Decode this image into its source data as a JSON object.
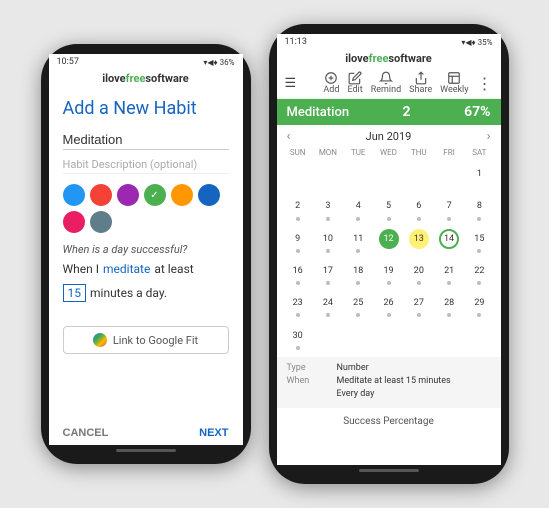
{
  "brand": {
    "name_part1": "ilove",
    "name_part2": "free",
    "name_part3": "software"
  },
  "left_phone": {
    "status": {
      "time": "10:57",
      "battery": "36%",
      "icons": "▾◀♦"
    },
    "title": "Add a New Habit",
    "habit_name_value": "Meditation",
    "habit_description_placeholder": "Habit Description (optional)",
    "colors": [
      {
        "color": "#2196f3",
        "active": false
      },
      {
        "color": "#f44336",
        "active": false
      },
      {
        "color": "#9c27b0",
        "active": false
      },
      {
        "color": "#4caf50",
        "active": true,
        "checkmark": "✓"
      },
      {
        "color": "#ff9800",
        "active": false
      },
      {
        "color": "#1565c0",
        "active": false
      },
      {
        "color": "#e91e63",
        "active": false
      },
      {
        "color": "#607d8b",
        "active": false
      }
    ],
    "when_question": "When is a day successful?",
    "when_prefix": "When I",
    "when_activity": "meditate",
    "when_condition": "at least",
    "minutes_value": "15",
    "minutes_label": "minutes a day.",
    "google_fit_label": "Link to Google Fit",
    "cancel_label": "CANCEL",
    "next_label": "NEXT"
  },
  "right_phone": {
    "status": {
      "time": "11:13",
      "battery": "35%",
      "icons": "▾◀♦"
    },
    "toolbar": {
      "add_label": "Add",
      "edit_label": "Edit",
      "remind_label": "Remind",
      "share_label": "Share",
      "weekly_label": "Weekly",
      "menu_icon": "⋮"
    },
    "habit_name": "Meditation",
    "habit_count": "2",
    "habit_percent": "67%",
    "calendar": {
      "nav_prev": "‹",
      "nav_next": "›",
      "month_year": "Jun 2019",
      "days": [
        "SUN",
        "MON",
        "TUE",
        "WED",
        "THU",
        "FRI",
        "SAT"
      ],
      "weeks": [
        [
          null,
          null,
          null,
          null,
          null,
          null,
          "1"
        ],
        [
          "2",
          "3",
          "4",
          "5",
          "6",
          "7",
          "8"
        ],
        [
          "9",
          "10",
          "11",
          "12",
          "13",
          "14",
          "15"
        ],
        [
          "16",
          "17",
          "18",
          "19",
          "20",
          "21",
          "22"
        ],
        [
          "23",
          "24",
          "25",
          "26",
          "27",
          "28",
          "29"
        ],
        [
          "30",
          null,
          null,
          null,
          null,
          null,
          null
        ]
      ],
      "highlighted": [
        "12",
        "13",
        "14"
      ]
    },
    "info": {
      "type_label": "Type",
      "type_value": "Number",
      "when_label": "When",
      "when_value": "Meditate at least 15 minutes",
      "freq_label": "",
      "freq_value": "Every day"
    },
    "success_label": "Success Percentage"
  }
}
